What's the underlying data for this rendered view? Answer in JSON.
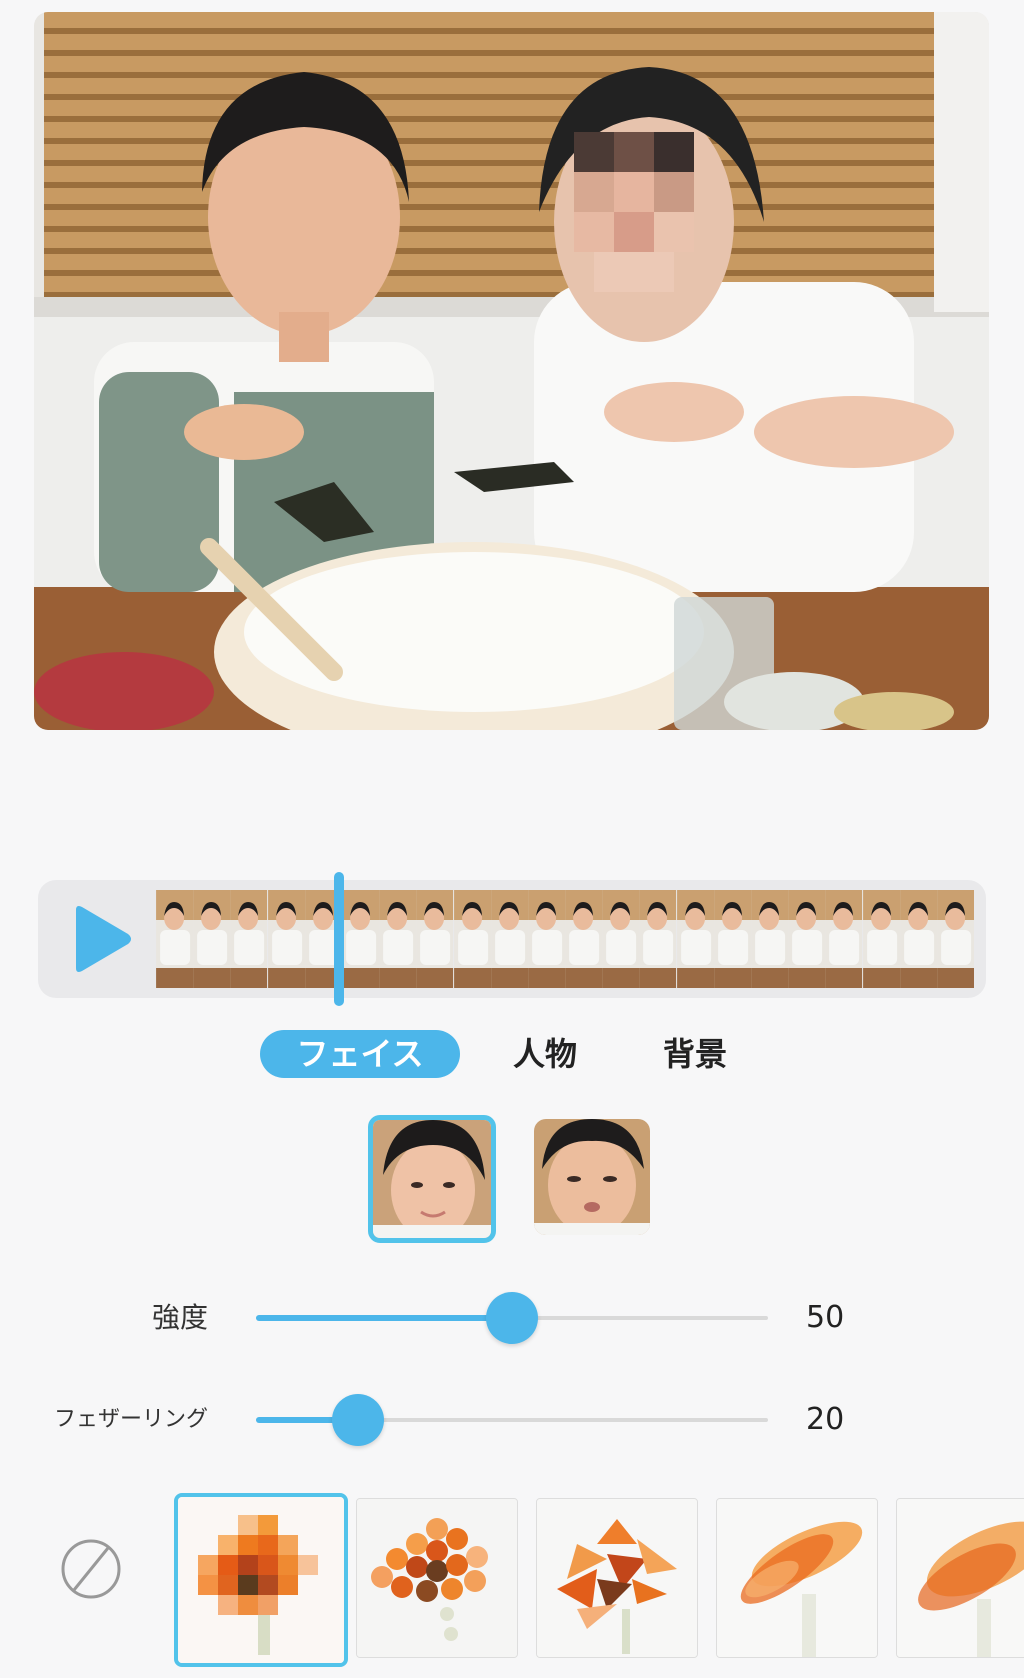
{
  "preview": {
    "icon": "family-photo-preview"
  },
  "timeline": {
    "play_icon": "play-icon",
    "accent_color": "#4cb6ea",
    "frame_count": 22
  },
  "tabs": [
    {
      "label": "フェイス",
      "active": true
    },
    {
      "label": "人物",
      "active": false
    },
    {
      "label": "背景",
      "active": false
    }
  ],
  "faces": [
    {
      "name": "face-girl",
      "selected": true
    },
    {
      "name": "face-boy",
      "selected": false
    }
  ],
  "sliders": [
    {
      "label": "強度",
      "value": "50",
      "fraction": 0.5
    },
    {
      "label": "フェザーリング",
      "value": "20",
      "fraction": 0.2
    }
  ],
  "effects": {
    "none_icon": "no-effect-icon",
    "items": [
      {
        "name": "mosaic-square",
        "selected": true
      },
      {
        "name": "mosaic-hexagon",
        "selected": false
      },
      {
        "name": "mosaic-triangle",
        "selected": false
      },
      {
        "name": "blur-motion",
        "selected": false
      },
      {
        "name": "blur-gaussian",
        "selected": false
      }
    ]
  }
}
